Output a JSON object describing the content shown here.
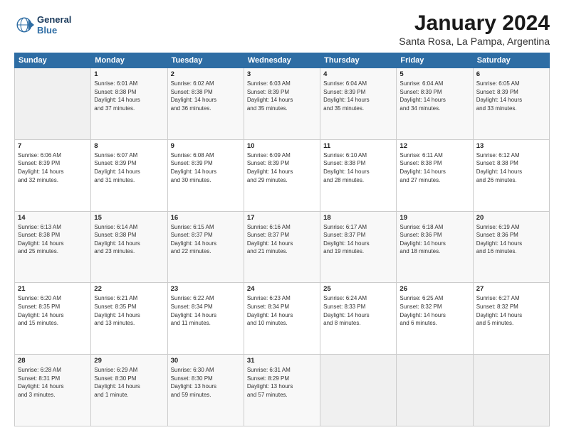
{
  "logo": {
    "line1": "General",
    "line2": "Blue"
  },
  "title": "January 2024",
  "subtitle": "Santa Rosa, La Pampa, Argentina",
  "headers": [
    "Sunday",
    "Monday",
    "Tuesday",
    "Wednesday",
    "Thursday",
    "Friday",
    "Saturday"
  ],
  "weeks": [
    [
      {
        "num": "",
        "info": ""
      },
      {
        "num": "1",
        "info": "Sunrise: 6:01 AM\nSunset: 8:38 PM\nDaylight: 14 hours\nand 37 minutes."
      },
      {
        "num": "2",
        "info": "Sunrise: 6:02 AM\nSunset: 8:38 PM\nDaylight: 14 hours\nand 36 minutes."
      },
      {
        "num": "3",
        "info": "Sunrise: 6:03 AM\nSunset: 8:39 PM\nDaylight: 14 hours\nand 35 minutes."
      },
      {
        "num": "4",
        "info": "Sunrise: 6:04 AM\nSunset: 8:39 PM\nDaylight: 14 hours\nand 35 minutes."
      },
      {
        "num": "5",
        "info": "Sunrise: 6:04 AM\nSunset: 8:39 PM\nDaylight: 14 hours\nand 34 minutes."
      },
      {
        "num": "6",
        "info": "Sunrise: 6:05 AM\nSunset: 8:39 PM\nDaylight: 14 hours\nand 33 minutes."
      }
    ],
    [
      {
        "num": "7",
        "info": "Sunrise: 6:06 AM\nSunset: 8:39 PM\nDaylight: 14 hours\nand 32 minutes."
      },
      {
        "num": "8",
        "info": "Sunrise: 6:07 AM\nSunset: 8:39 PM\nDaylight: 14 hours\nand 31 minutes."
      },
      {
        "num": "9",
        "info": "Sunrise: 6:08 AM\nSunset: 8:39 PM\nDaylight: 14 hours\nand 30 minutes."
      },
      {
        "num": "10",
        "info": "Sunrise: 6:09 AM\nSunset: 8:39 PM\nDaylight: 14 hours\nand 29 minutes."
      },
      {
        "num": "11",
        "info": "Sunrise: 6:10 AM\nSunset: 8:38 PM\nDaylight: 14 hours\nand 28 minutes."
      },
      {
        "num": "12",
        "info": "Sunrise: 6:11 AM\nSunset: 8:38 PM\nDaylight: 14 hours\nand 27 minutes."
      },
      {
        "num": "13",
        "info": "Sunrise: 6:12 AM\nSunset: 8:38 PM\nDaylight: 14 hours\nand 26 minutes."
      }
    ],
    [
      {
        "num": "14",
        "info": "Sunrise: 6:13 AM\nSunset: 8:38 PM\nDaylight: 14 hours\nand 25 minutes."
      },
      {
        "num": "15",
        "info": "Sunrise: 6:14 AM\nSunset: 8:38 PM\nDaylight: 14 hours\nand 23 minutes."
      },
      {
        "num": "16",
        "info": "Sunrise: 6:15 AM\nSunset: 8:37 PM\nDaylight: 14 hours\nand 22 minutes."
      },
      {
        "num": "17",
        "info": "Sunrise: 6:16 AM\nSunset: 8:37 PM\nDaylight: 14 hours\nand 21 minutes."
      },
      {
        "num": "18",
        "info": "Sunrise: 6:17 AM\nSunset: 8:37 PM\nDaylight: 14 hours\nand 19 minutes."
      },
      {
        "num": "19",
        "info": "Sunrise: 6:18 AM\nSunset: 8:36 PM\nDaylight: 14 hours\nand 18 minutes."
      },
      {
        "num": "20",
        "info": "Sunrise: 6:19 AM\nSunset: 8:36 PM\nDaylight: 14 hours\nand 16 minutes."
      }
    ],
    [
      {
        "num": "21",
        "info": "Sunrise: 6:20 AM\nSunset: 8:35 PM\nDaylight: 14 hours\nand 15 minutes."
      },
      {
        "num": "22",
        "info": "Sunrise: 6:21 AM\nSunset: 8:35 PM\nDaylight: 14 hours\nand 13 minutes."
      },
      {
        "num": "23",
        "info": "Sunrise: 6:22 AM\nSunset: 8:34 PM\nDaylight: 14 hours\nand 11 minutes."
      },
      {
        "num": "24",
        "info": "Sunrise: 6:23 AM\nSunset: 8:34 PM\nDaylight: 14 hours\nand 10 minutes."
      },
      {
        "num": "25",
        "info": "Sunrise: 6:24 AM\nSunset: 8:33 PM\nDaylight: 14 hours\nand 8 minutes."
      },
      {
        "num": "26",
        "info": "Sunrise: 6:25 AM\nSunset: 8:32 PM\nDaylight: 14 hours\nand 6 minutes."
      },
      {
        "num": "27",
        "info": "Sunrise: 6:27 AM\nSunset: 8:32 PM\nDaylight: 14 hours\nand 5 minutes."
      }
    ],
    [
      {
        "num": "28",
        "info": "Sunrise: 6:28 AM\nSunset: 8:31 PM\nDaylight: 14 hours\nand 3 minutes."
      },
      {
        "num": "29",
        "info": "Sunrise: 6:29 AM\nSunset: 8:30 PM\nDaylight: 14 hours\nand 1 minute."
      },
      {
        "num": "30",
        "info": "Sunrise: 6:30 AM\nSunset: 8:30 PM\nDaylight: 13 hours\nand 59 minutes."
      },
      {
        "num": "31",
        "info": "Sunrise: 6:31 AM\nSunset: 8:29 PM\nDaylight: 13 hours\nand 57 minutes."
      },
      {
        "num": "",
        "info": ""
      },
      {
        "num": "",
        "info": ""
      },
      {
        "num": "",
        "info": ""
      }
    ]
  ]
}
